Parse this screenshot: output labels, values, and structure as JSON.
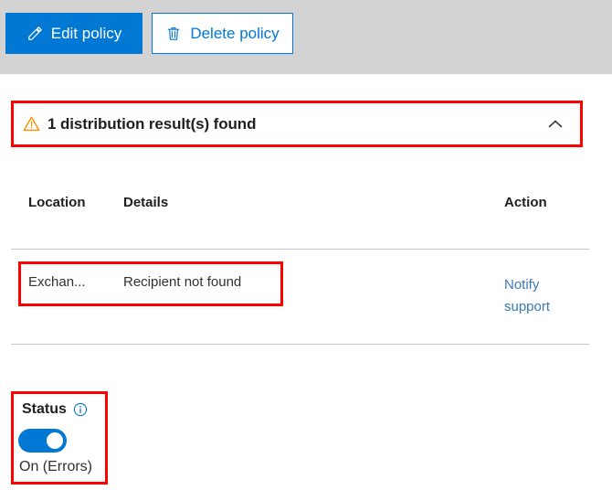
{
  "commandbar": {
    "buttons": [
      {
        "label": "Edit policy",
        "icon": "pencil-icon",
        "style": "primary"
      },
      {
        "label": "Delete policy",
        "icon": "trash-icon",
        "style": "secondary"
      }
    ]
  },
  "banner": {
    "icon": "warning-triangle-icon",
    "text": "1 distribution result(s) found",
    "chevron": "chevron-up-icon",
    "highlight_color": "#FE0000",
    "warning_color": "#FF8C00"
  },
  "results_table": {
    "columns": [
      "Location",
      "Details",
      "Action"
    ],
    "rows": [
      {
        "location": "Exchan...",
        "details": "Recipient not found",
        "action": "Notify support",
        "highlighted": true
      }
    ],
    "link_color": "#3B78B8"
  },
  "status": {
    "label": "Status",
    "info_icon": "info-circle-icon",
    "toggle_on": true,
    "value": "On (Errors)",
    "accent_color": "#0078D4",
    "highlight_color": "#FE0000"
  }
}
